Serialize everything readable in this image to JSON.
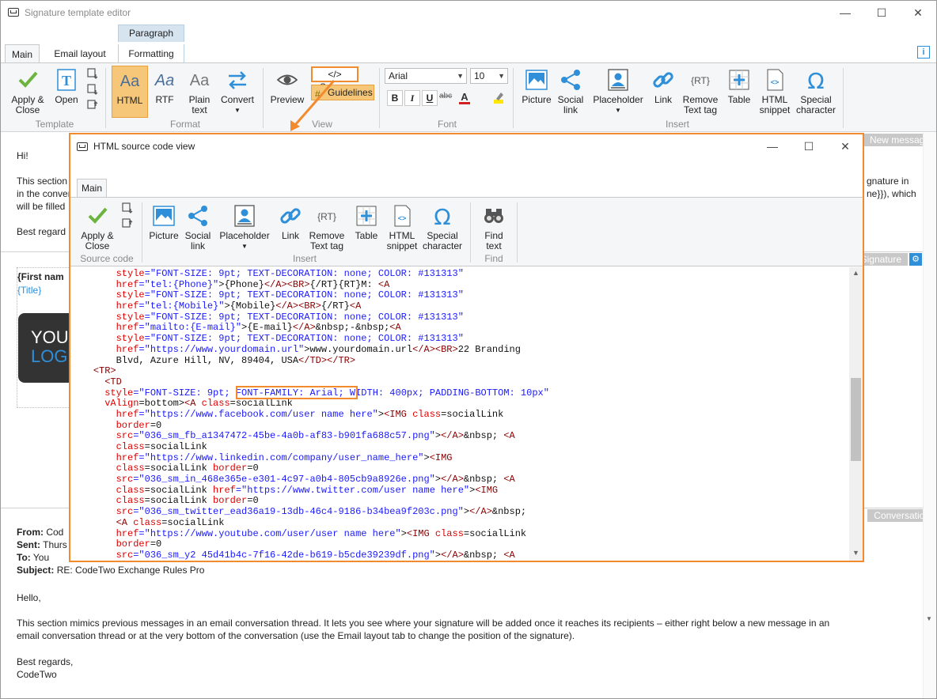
{
  "app": {
    "title": "Signature template editor"
  },
  "context_tab": "Paragraph",
  "tabs": [
    "Main",
    "Email layout",
    "Formatting"
  ],
  "ribbon": {
    "template": {
      "apply_close_1": "Apply &",
      "apply_close_2": "Close",
      "open": "Open",
      "group": "Template"
    },
    "format": {
      "html": "HTML",
      "rtf": "RTF",
      "plain_1": "Plain",
      "plain_2": "text",
      "convert": "Convert",
      "group": "Format"
    },
    "view": {
      "preview": "Preview",
      "source": "</> Source",
      "guidelines": "Guidelines",
      "group": "View"
    },
    "font": {
      "family": "Arial",
      "size": "10",
      "bold": "B",
      "italic": "I",
      "underline": "U",
      "strike": "abc",
      "group": "Font"
    },
    "insert": {
      "picture": "Picture",
      "social_1": "Social",
      "social_2": "link",
      "placeholder": "Placeholder",
      "link": "Link",
      "remove_1": "Remove",
      "remove_2": "Text tag",
      "table": "Table",
      "html_1": "HTML",
      "html_2": "snippet",
      "special_1": "Special",
      "special_2": "character",
      "group": "Insert"
    },
    "info": "i"
  },
  "doc": {
    "band_new": "New message",
    "band_sig": "Signature",
    "band_conv": "Conversation",
    "hi": "Hi!",
    "p1_start": "This section",
    "p1_line2": "in the convers",
    "p1_line3": "will be filled",
    "p1_right1": "gnature in",
    "p1_right2": "ne}}), which",
    "best1": "Best regard",
    "sig_name": "{First nam",
    "sig_title": "{Title}",
    "logo_1": "YOU",
    "logo_2": "LOG",
    "from_lbl": "From:",
    "from_val": "Cod",
    "sent_lbl": "Sent:",
    "sent_val": "Thurs",
    "to_lbl": "To:",
    "to_val": "You",
    "subj_lbl": "Subject:",
    "subj_val": "RE: CodeTwo Exchange Rules Pro",
    "hello": "Hello,",
    "conv_p1": "This section mimics previous messages in an email conversation thread. It lets you see where your signature will be added once it reaches its recipients – either right below a new message in an",
    "conv_p2": "email conversation thread or at the very bottom of the conversation (use the Email layout tab to change the position of the signature).",
    "best2": "Best regards,",
    "codetwo": "CodeTwo"
  },
  "dialog": {
    "title": "HTML source code view",
    "tab": "Main",
    "source_group": "Source code",
    "insert_group": "Insert",
    "find_group": "Find",
    "find_1": "Find",
    "find_2": "text"
  },
  "code_lines": [
    [
      [
        "        ",
        "x"
      ],
      [
        "style",
        "a"
      ],
      [
        "=\"FONT-SIZE: 9pt; TEXT-DECORATION: none; COLOR: #131313\"",
        "v"
      ]
    ],
    [
      [
        "        ",
        "x"
      ],
      [
        "href",
        "a"
      ],
      [
        "=\"tel:{Phone}\"",
        "v"
      ],
      [
        ">{Phone}",
        "x"
      ],
      [
        "</A><BR>",
        "t"
      ],
      [
        "{/RT}{RT}M: ",
        "x"
      ],
      [
        "<A",
        "t"
      ]
    ],
    [
      [
        "        ",
        "x"
      ],
      [
        "style",
        "a"
      ],
      [
        "=\"FONT-SIZE: 9pt; TEXT-DECORATION: none; COLOR: #131313\"",
        "v"
      ]
    ],
    [
      [
        "        ",
        "x"
      ],
      [
        "href",
        "a"
      ],
      [
        "=\"tel:{Mobile}\"",
        "v"
      ],
      [
        ">{Mobile}",
        "x"
      ],
      [
        "</A><BR>",
        "t"
      ],
      [
        "{/RT}",
        "x"
      ],
      [
        "<A",
        "t"
      ]
    ],
    [
      [
        "        ",
        "x"
      ],
      [
        "style",
        "a"
      ],
      [
        "=\"FONT-SIZE: 9pt; TEXT-DECORATION: none; COLOR: #131313\"",
        "v"
      ]
    ],
    [
      [
        "        ",
        "x"
      ],
      [
        "href",
        "a"
      ],
      [
        "=\"mailto:{E-mail}\"",
        "v"
      ],
      [
        ">{E-mail}",
        "x"
      ],
      [
        "</A>",
        "t"
      ],
      [
        "&nbsp;-&nbsp;",
        "x"
      ],
      [
        "<A",
        "t"
      ]
    ],
    [
      [
        "        ",
        "x"
      ],
      [
        "style",
        "a"
      ],
      [
        "=\"FONT-SIZE: 9pt; TEXT-DECORATION: none; COLOR: #131313\"",
        "v"
      ]
    ],
    [
      [
        "        ",
        "x"
      ],
      [
        "href",
        "a"
      ],
      [
        "=\"https://www.yourdomain.url\"",
        "v"
      ],
      [
        ">www.yourdomain.url",
        "x"
      ],
      [
        "</A><BR>",
        "t"
      ],
      [
        "22 Branding",
        "x"
      ]
    ],
    [
      [
        "        Blvd, Azure Hill, NV, 89404, USA",
        "x"
      ],
      [
        "</TD></TR>",
        "t"
      ]
    ],
    [
      [
        "    ",
        "x"
      ],
      [
        "<TR>",
        "t"
      ]
    ],
    [
      [
        "      ",
        "x"
      ],
      [
        "<TD",
        "t"
      ]
    ],
    [
      [
        "      ",
        "x"
      ],
      [
        "style",
        "a"
      ],
      [
        "=\"FONT-SIZE: 9pt; ",
        "v"
      ],
      [
        "FONT-FAMILY: Arial;",
        "v"
      ],
      [
        " WIDTH: 400px; PADDING-BOTTOM: 10px\"",
        "v"
      ]
    ],
    [
      [
        "      ",
        "x"
      ],
      [
        "vAlign",
        "a"
      ],
      [
        "=bottom>",
        "x"
      ],
      [
        "<A ",
        "t"
      ],
      [
        "class",
        "a"
      ],
      [
        "=socialLink",
        "x"
      ]
    ],
    [
      [
        "        ",
        "x"
      ],
      [
        "href",
        "a"
      ],
      [
        "=\"https://www.facebook.com/user name here\"",
        "v"
      ],
      [
        ">",
        "x"
      ],
      [
        "<IMG ",
        "t"
      ],
      [
        "class",
        "a"
      ],
      [
        "=socialLink",
        "x"
      ]
    ],
    [
      [
        "        ",
        "x"
      ],
      [
        "border",
        "a"
      ],
      [
        "=0",
        "x"
      ]
    ],
    [
      [
        "        ",
        "x"
      ],
      [
        "src",
        "a"
      ],
      [
        "=\"036_sm_fb_a1347472-45be-4a0b-af83-b901fa688c57.png\"",
        "v"
      ],
      [
        ">",
        "x"
      ],
      [
        "</A>",
        "t"
      ],
      [
        "&nbsp; ",
        "x"
      ],
      [
        "<A",
        "t"
      ]
    ],
    [
      [
        "        ",
        "x"
      ],
      [
        "class",
        "a"
      ],
      [
        "=socialLink",
        "x"
      ]
    ],
    [
      [
        "        ",
        "x"
      ],
      [
        "href",
        "a"
      ],
      [
        "=\"https://www.linkedin.com/company/user_name_here\"",
        "v"
      ],
      [
        ">",
        "x"
      ],
      [
        "<IMG",
        "t"
      ]
    ],
    [
      [
        "        ",
        "x"
      ],
      [
        "class",
        "a"
      ],
      [
        "=socialLink ",
        "x"
      ],
      [
        "border",
        "a"
      ],
      [
        "=0",
        "x"
      ]
    ],
    [
      [
        "        ",
        "x"
      ],
      [
        "src",
        "a"
      ],
      [
        "=\"036_sm_in_468e365e-e301-4c97-a0b4-805cb9a8926e.png\"",
        "v"
      ],
      [
        ">",
        "x"
      ],
      [
        "</A>",
        "t"
      ],
      [
        "&nbsp; ",
        "x"
      ],
      [
        "<A",
        "t"
      ]
    ],
    [
      [
        "        ",
        "x"
      ],
      [
        "class",
        "a"
      ],
      [
        "=socialLink ",
        "x"
      ],
      [
        "href",
        "a"
      ],
      [
        "=\"https://www.twitter.com/user name here\"",
        "v"
      ],
      [
        ">",
        "x"
      ],
      [
        "<IMG",
        "t"
      ]
    ],
    [
      [
        "        ",
        "x"
      ],
      [
        "class",
        "a"
      ],
      [
        "=socialLink ",
        "x"
      ],
      [
        "border",
        "a"
      ],
      [
        "=0",
        "x"
      ]
    ],
    [
      [
        "        ",
        "x"
      ],
      [
        "src",
        "a"
      ],
      [
        "=\"036_sm_twitter_ead36a19-13db-46c4-9186-b34bea9f203c.png\"",
        "v"
      ],
      [
        ">",
        "x"
      ],
      [
        "</A>",
        "t"
      ],
      [
        "&nbsp;",
        "x"
      ]
    ],
    [
      [
        "        ",
        "x"
      ],
      [
        "<A ",
        "t"
      ],
      [
        "class",
        "a"
      ],
      [
        "=socialLink",
        "x"
      ]
    ],
    [
      [
        "        ",
        "x"
      ],
      [
        "href",
        "a"
      ],
      [
        "=\"https://www.youtube.com/user/user name here\"",
        "v"
      ],
      [
        ">",
        "x"
      ],
      [
        "<IMG ",
        "t"
      ],
      [
        "class",
        "a"
      ],
      [
        "=socialLink",
        "x"
      ]
    ],
    [
      [
        "        ",
        "x"
      ],
      [
        "border",
        "a"
      ],
      [
        "=0",
        "x"
      ]
    ],
    [
      [
        "        ",
        "x"
      ],
      [
        "src",
        "a"
      ],
      [
        "=\"036_sm_y2 45d41b4c-7f16-42de-b619-b5cde39239df.png\"",
        "v"
      ],
      [
        ">",
        "x"
      ],
      [
        "</A>",
        "t"
      ],
      [
        "&nbsp; ",
        "x"
      ],
      [
        "<A",
        "t"
      ]
    ]
  ],
  "colors": {
    "accent_orange": "#f28a2e",
    "tag": "#8b0000",
    "attr": "#e00000",
    "value": "#1a1aff",
    "link_blue": "#2f8fd8"
  }
}
